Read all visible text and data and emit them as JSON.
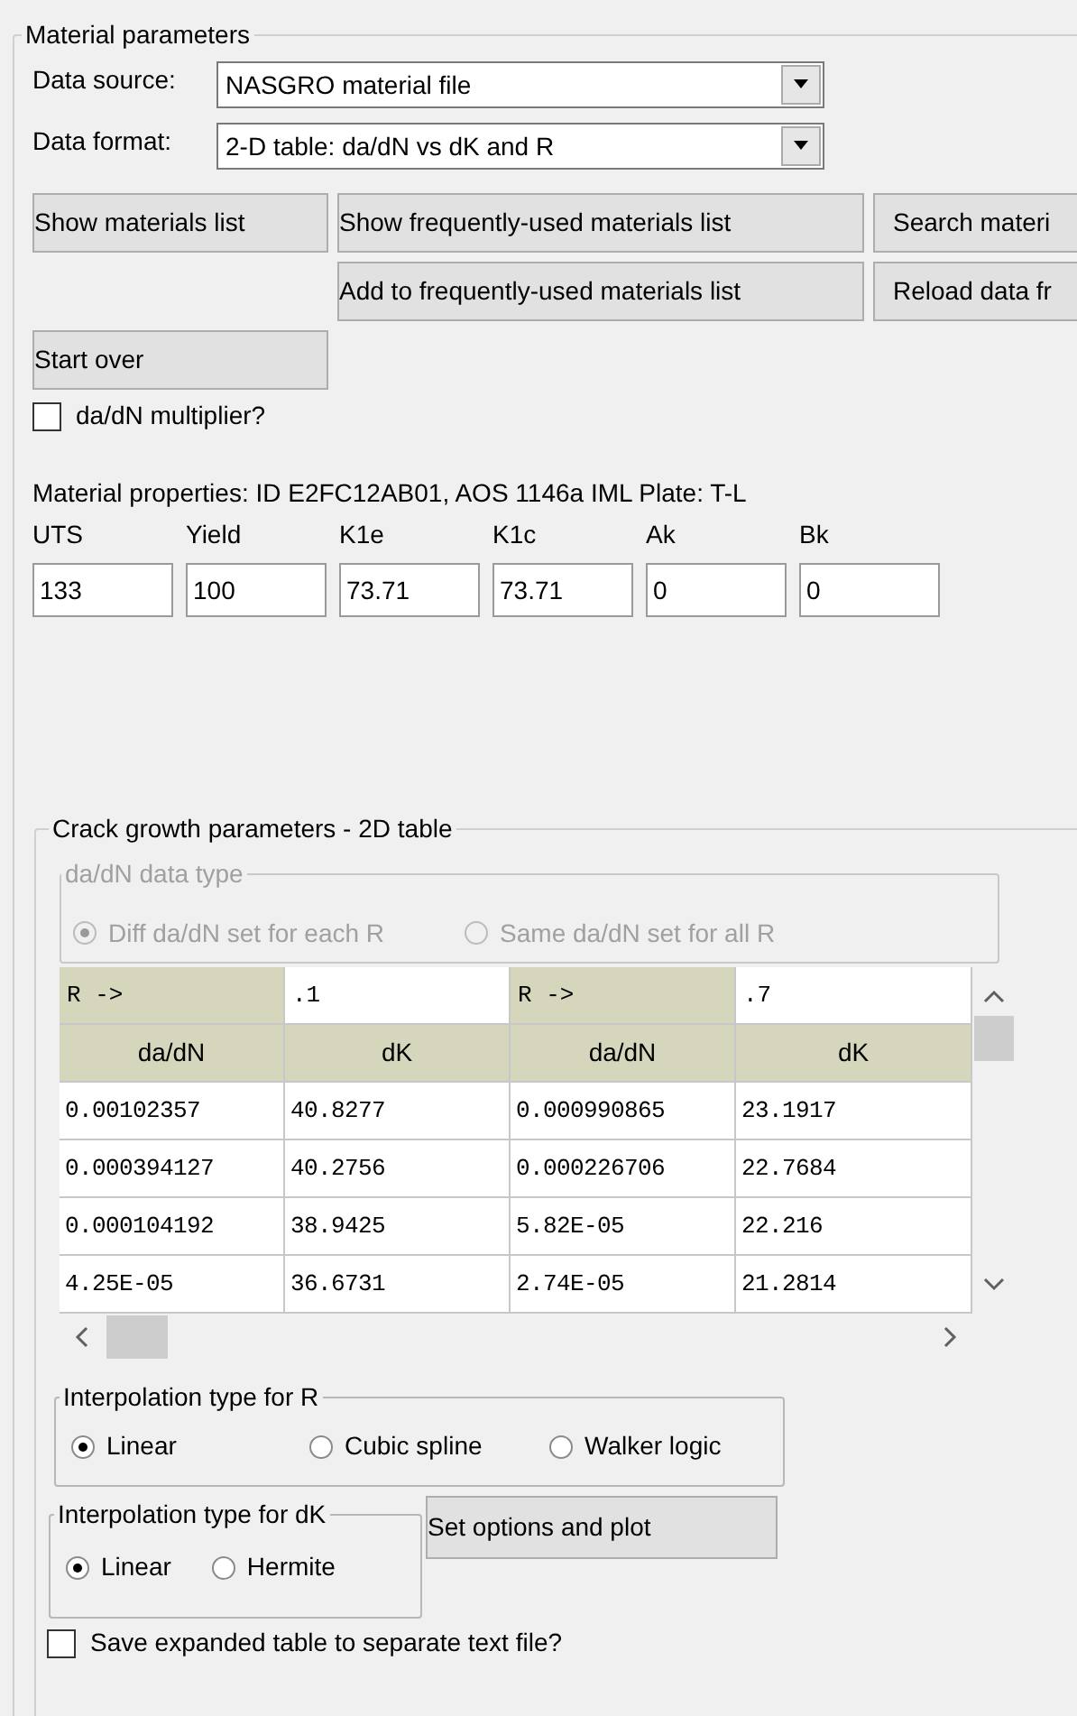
{
  "material_parameters": {
    "title": "Material parameters",
    "selects": [
      {
        "label": "Data source:",
        "value": "NASGRO material file"
      },
      {
        "label": "Data format:",
        "value": "2-D table: da/dN vs dK and R"
      }
    ],
    "buttons_row_1": [
      "Show materials list",
      "Show frequently-used materials list",
      "Search materi"
    ],
    "buttons_row_2": [
      "Add to frequently-used materials list",
      "Reload data fr"
    ],
    "start_over_button": "Start over",
    "multiplier_checkbox": {
      "label": "da/dN multiplier?",
      "checked": false
    },
    "properties_title": "Material properties: ID E2FC12AB01, AOS 1146a IML Plate: T-L",
    "properties": [
      {
        "label": "UTS",
        "value": "133"
      },
      {
        "label": "Yield",
        "value": "100"
      },
      {
        "label": "K1e",
        "value": "73.71"
      },
      {
        "label": "K1c",
        "value": "73.71"
      },
      {
        "label": "Ak",
        "value": "0"
      },
      {
        "label": "Bk",
        "value": "0"
      }
    ],
    "crack_growth": {
      "title": "Crack growth parameters - 2D table",
      "data_type": {
        "title": "da/dN data type",
        "disabled": true,
        "options": [
          {
            "label": "Diff da/dN set for each R",
            "selected": true
          },
          {
            "label": "Same da/dN set for all R",
            "selected": false
          }
        ]
      },
      "table": {
        "r_row": [
          {
            "label": "R ->",
            "value": ".1"
          },
          {
            "label": "R ->",
            "value": ".7"
          }
        ],
        "columns": [
          "da/dN",
          "dK",
          "da/dN",
          "dK"
        ],
        "rows": [
          [
            "0.00102357",
            "40.8277",
            "0.000990865",
            "23.1917"
          ],
          [
            "0.000394127",
            "40.2756",
            "0.000226706",
            "22.7684"
          ],
          [
            "0.000104192",
            "38.9425",
            "5.82E-05",
            "22.216"
          ],
          [
            "4.25E-05",
            "36.6731",
            "2.74E-05",
            "21.2814"
          ]
        ]
      },
      "interp_r": {
        "title": "Interpolation type for R",
        "options": [
          {
            "label": "Linear",
            "selected": true
          },
          {
            "label": "Cubic spline",
            "selected": false
          },
          {
            "label": "Walker logic",
            "selected": false
          }
        ]
      },
      "interp_dk": {
        "title": "Interpolation type for dK",
        "options": [
          {
            "label": "Linear",
            "selected": true
          },
          {
            "label": "Hermite",
            "selected": false
          }
        ]
      },
      "plot_button": "Set options and plot",
      "save_checkbox": {
        "label": "Save expanded table to separate text file?",
        "checked": false
      }
    }
  }
}
